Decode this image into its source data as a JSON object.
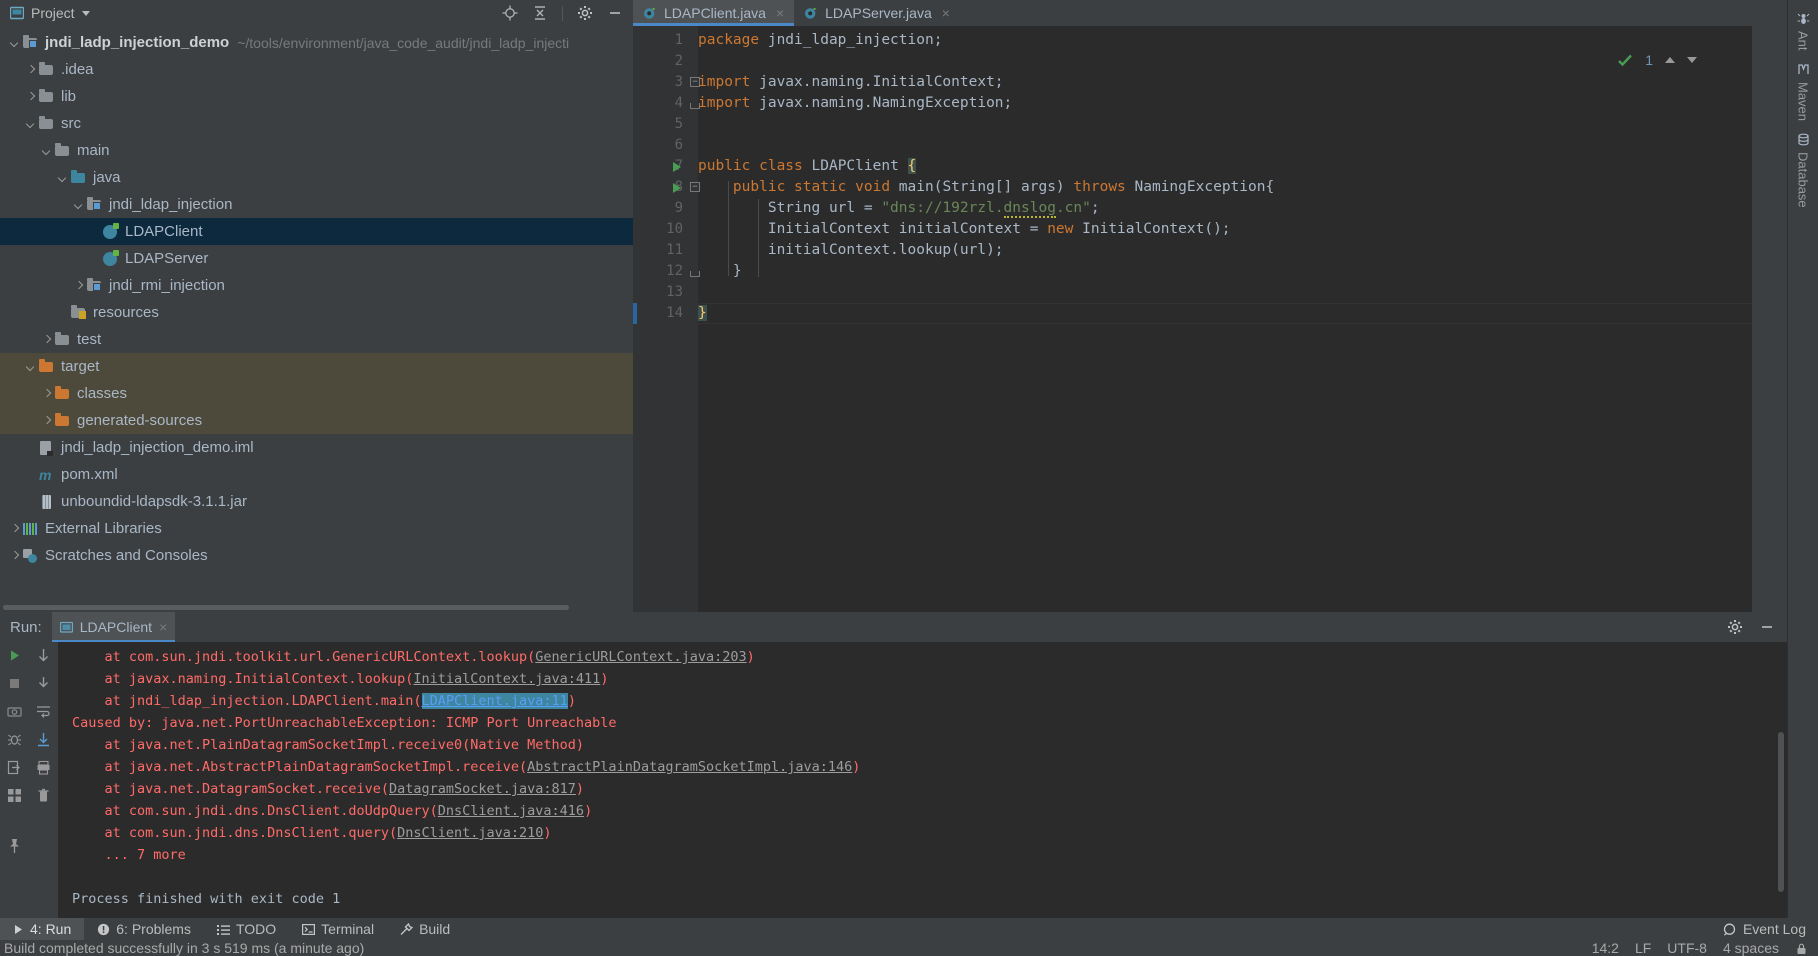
{
  "window": {
    "project_panel_title": "Project",
    "project_caret_icon": "chevron-down-icon",
    "toolbar_icons": [
      "locate-icon",
      "collapse-all-icon",
      "gear-icon",
      "minimize-icon"
    ]
  },
  "tabs": [
    {
      "label": "LDAPClient.java",
      "icon": "java-class-icon",
      "close": "×",
      "active": true
    },
    {
      "label": "LDAPServer.java",
      "icon": "java-class-icon",
      "close": "×",
      "active": false
    }
  ],
  "project_tree": [
    {
      "label": "jndi_ladp_injection_demo",
      "path": "~/tools/environment/java_code_audit/jndi_ladp_injecti",
      "indent": 0,
      "arrow": "down",
      "icon": "module-icon",
      "bold": true
    },
    {
      "label": ".idea",
      "indent": 1,
      "arrow": "right",
      "icon": "folder-gray-icon"
    },
    {
      "label": "lib",
      "indent": 1,
      "arrow": "right",
      "icon": "folder-gray-icon"
    },
    {
      "label": "src",
      "indent": 1,
      "arrow": "down",
      "icon": "folder-gray-icon"
    },
    {
      "label": "main",
      "indent": 2,
      "arrow": "down",
      "icon": "folder-gray-icon"
    },
    {
      "label": "java",
      "indent": 3,
      "arrow": "down",
      "icon": "folder-source-icon"
    },
    {
      "label": "jndi_ldap_injection",
      "indent": 4,
      "arrow": "down",
      "icon": "package-icon"
    },
    {
      "label": "LDAPClient",
      "indent": 5,
      "arrow": "none",
      "icon": "java-class-icon",
      "selected": true
    },
    {
      "label": "LDAPServer",
      "indent": 5,
      "arrow": "none",
      "icon": "java-class-icon"
    },
    {
      "label": "jndi_rmi_injection",
      "indent": 4,
      "arrow": "right",
      "icon": "package-icon"
    },
    {
      "label": "resources",
      "indent": 3,
      "arrow": "none",
      "icon": "folder-resources-icon"
    },
    {
      "label": "test",
      "indent": 2,
      "arrow": "right",
      "icon": "folder-gray-icon"
    },
    {
      "label": "target",
      "indent": 1,
      "arrow": "down",
      "icon": "folder-orange-icon",
      "highlight": true
    },
    {
      "label": "classes",
      "indent": 2,
      "arrow": "right",
      "icon": "folder-orange-icon",
      "highlight": true
    },
    {
      "label": "generated-sources",
      "indent": 2,
      "arrow": "right",
      "icon": "folder-orange-icon",
      "highlight": true
    },
    {
      "label": "jndi_ladp_injection_demo.iml",
      "indent": 1,
      "arrow": "none",
      "icon": "iml-file-icon"
    },
    {
      "label": "pom.xml",
      "indent": 1,
      "arrow": "none",
      "icon": "maven-file-icon"
    },
    {
      "label": "unboundid-ldapsdk-3.1.1.jar",
      "indent": 1,
      "arrow": "none",
      "icon": "jar-file-icon"
    },
    {
      "label": "External Libraries",
      "indent": 0,
      "arrow": "right",
      "icon": "libraries-icon"
    },
    {
      "label": "Scratches and Consoles",
      "indent": 0,
      "arrow": "right",
      "icon": "scratches-icon"
    }
  ],
  "editor": {
    "filename": "LDAPClient.java",
    "inspection_count": "1",
    "inspection_icon": "inspection-ok-icon",
    "nav_up_icon": "chevron-up-icon",
    "nav_down_icon": "chevron-down-icon",
    "lines": [
      {
        "n": "1",
        "tokens": [
          {
            "t": "package ",
            "c": "kw"
          },
          {
            "t": "jndi_ldap_injection;",
            "c": "id"
          }
        ]
      },
      {
        "n": "2",
        "tokens": []
      },
      {
        "n": "3",
        "tokens": [
          {
            "t": "import ",
            "c": "kw"
          },
          {
            "t": "javax.naming.InitialContext;",
            "c": "id"
          }
        ],
        "fold": "start"
      },
      {
        "n": "4",
        "tokens": [
          {
            "t": "import ",
            "c": "kw"
          },
          {
            "t": "javax.naming.NamingException;",
            "c": "id"
          }
        ],
        "fold": "end"
      },
      {
        "n": "5",
        "tokens": []
      },
      {
        "n": "6",
        "tokens": []
      },
      {
        "n": "7",
        "tokens": [
          {
            "t": "public class ",
            "c": "kw"
          },
          {
            "t": "LDAPClient ",
            "c": "id"
          },
          {
            "t": "{",
            "c": "hl-brace"
          }
        ],
        "run": true
      },
      {
        "n": "8",
        "tokens": [
          {
            "t": "    public static void ",
            "c": "kw"
          },
          {
            "t": "main",
            "c": "mth"
          },
          {
            "t": "(String[] args) ",
            "c": "id"
          },
          {
            "t": "throws ",
            "c": "kw"
          },
          {
            "t": "NamingException{",
            "c": "id"
          }
        ],
        "run": true,
        "fold": "start"
      },
      {
        "n": "9",
        "tokens": [
          {
            "t": "        String url = ",
            "c": "id"
          },
          {
            "t": "\"dns://192rzl.",
            "c": "st"
          },
          {
            "t": "dnslog",
            "c": "st warnu"
          },
          {
            "t": ".cn\"",
            "c": "st"
          },
          {
            "t": ";",
            "c": "id"
          }
        ]
      },
      {
        "n": "10",
        "tokens": [
          {
            "t": "        InitialContext initialContext = ",
            "c": "id"
          },
          {
            "t": "new ",
            "c": "kw"
          },
          {
            "t": "InitialContext();",
            "c": "id"
          }
        ]
      },
      {
        "n": "11",
        "tokens": [
          {
            "t": "        initialContext.lookup(url);",
            "c": "id"
          }
        ]
      },
      {
        "n": "12",
        "tokens": [
          {
            "t": "    }",
            "c": "id"
          }
        ],
        "fold": "end"
      },
      {
        "n": "13",
        "tokens": []
      },
      {
        "n": "14",
        "tokens": [
          {
            "t": "}",
            "c": "hl-brace"
          }
        ],
        "current": true
      }
    ]
  },
  "right_strip": [
    {
      "label": "Ant",
      "icon": "ant-icon"
    },
    {
      "label": "Maven",
      "icon": "maven-icon"
    },
    {
      "label": "Database",
      "icon": "database-icon"
    }
  ],
  "run_panel": {
    "title": "Run:",
    "tab_label": "LDAPClient",
    "tab_icon": "run-config-icon",
    "tab_close": "×",
    "settings_icon": "gear-icon",
    "minimize_icon": "minimize-icon",
    "tool_icons": [
      "rerun-icon",
      "scroll-down-icon",
      "stop-icon",
      "soft-wrap-icon",
      "camera-icon",
      "print-icon",
      "thread-dump-icon",
      "export-icon",
      "trash-icon",
      "layout-icon",
      "pin-icon"
    ],
    "console": [
      {
        "c": "err",
        "text": "    at com.sun.jndi.toolkit.url.GenericURLContext.lookup(",
        "link": "GenericURLContext.java:203",
        "link_color": "gray",
        "tail": ")"
      },
      {
        "c": "err",
        "text": "    at javax.naming.InitialContext.lookup(",
        "link": "InitialContext.java:411",
        "link_color": "gray",
        "tail": ")"
      },
      {
        "c": "err",
        "text": "    at jndi_ldap_injection.LDAPClient.main(",
        "link": "LDAPClient.java:11",
        "link_color": "blue",
        "tail": ")"
      },
      {
        "c": "err",
        "text": "Caused by: java.net.PortUnreachableException: ICMP Port Unreachable"
      },
      {
        "c": "err",
        "text": "    at java.net.PlainDatagramSocketImpl.receive0(Native Method)"
      },
      {
        "c": "err",
        "text": "    at java.net.AbstractPlainDatagramSocketImpl.receive(",
        "link": "AbstractPlainDatagramSocketImpl.java:146",
        "link_color": "gray",
        "tail": ")"
      },
      {
        "c": "err",
        "text": "    at java.net.DatagramSocket.receive(",
        "link": "DatagramSocket.java:817",
        "link_color": "gray",
        "tail": ")"
      },
      {
        "c": "err",
        "text": "    at com.sun.jndi.dns.DnsClient.doUdpQuery(",
        "link": "DnsClient.java:416",
        "link_color": "gray",
        "tail": ")"
      },
      {
        "c": "err",
        "text": "    at com.sun.jndi.dns.DnsClient.query(",
        "link": "DnsClient.java:210",
        "link_color": "gray",
        "tail": ")"
      },
      {
        "c": "err",
        "text": "    ... 7 more"
      },
      {
        "c": "gray2",
        "text": ""
      },
      {
        "c": "gray2",
        "text": "Process finished with exit code 1"
      }
    ]
  },
  "tool_window_bar": {
    "items": [
      {
        "label": "4: Run",
        "mnemonic": "4",
        "icon": "play-icon",
        "active": true
      },
      {
        "label": "6: Problems",
        "mnemonic": "6",
        "icon": "problems-icon"
      },
      {
        "label": "TODO",
        "icon": "todo-icon"
      },
      {
        "label": "Terminal",
        "icon": "terminal-icon"
      },
      {
        "label": "Build",
        "icon": "build-icon"
      }
    ],
    "event_log": {
      "label": "Event Log",
      "icon": "event-log-icon"
    }
  },
  "status_bar": {
    "message": "Build completed successfully in 3 s 519 ms (a minute ago)",
    "caret": "14:2",
    "line_separator": "LF",
    "encoding": "UTF-8",
    "indent": "4 spaces",
    "lock_icon": "lock-icon"
  },
  "colors": {
    "accent": "#4A88C7",
    "selection": "#0D293E",
    "highlight": "#4E4A3B",
    "keyword": "#CC7832",
    "string": "#6A8759",
    "error": "#FF6B68",
    "link": "#589DF6",
    "ok": "#62B543"
  }
}
